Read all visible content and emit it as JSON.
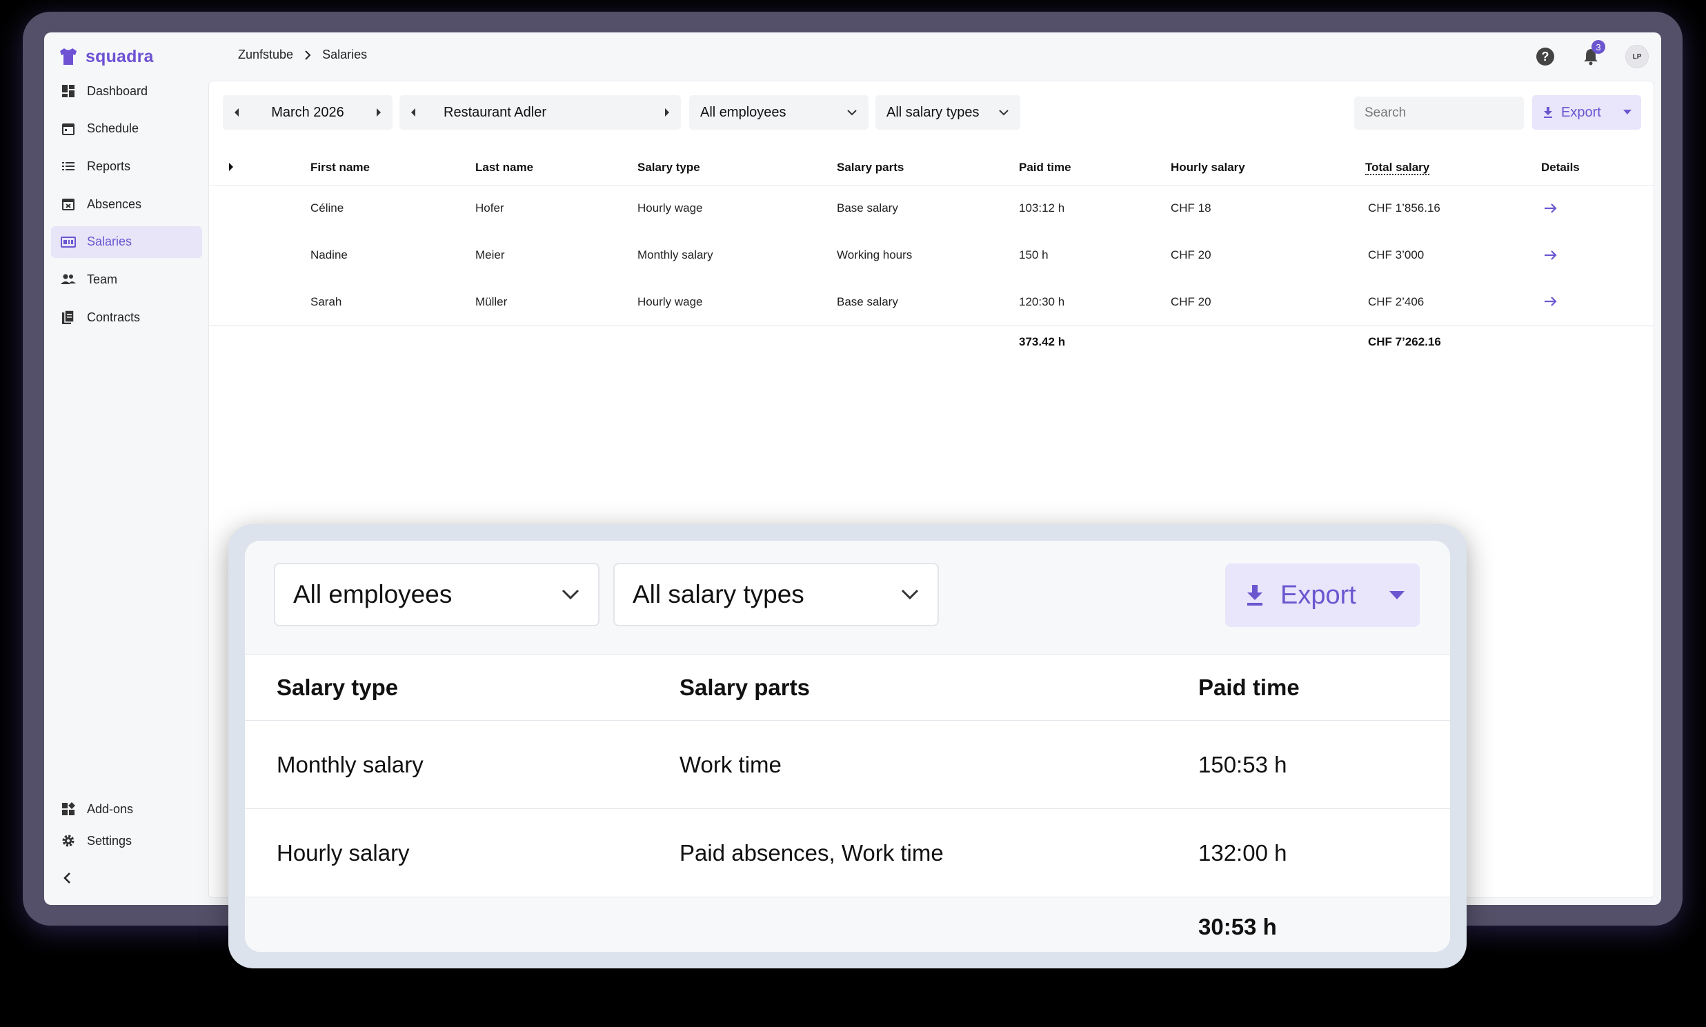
{
  "app": {
    "name": "squadra",
    "brand_color": "#6e52d3"
  },
  "breadcrumb": [
    "Zunfstube",
    "Salaries"
  ],
  "notifications": {
    "count": "3"
  },
  "user": {
    "initials": "LP"
  },
  "sidebar": {
    "items": [
      {
        "label": "Dashboard",
        "icon": "dashboard-icon"
      },
      {
        "label": "Schedule",
        "icon": "calendar-icon"
      },
      {
        "label": "Reports",
        "icon": "list-icon"
      },
      {
        "label": "Absences",
        "icon": "calendar-x-icon"
      },
      {
        "label": "Salaries",
        "icon": "salary-icon",
        "active": true
      },
      {
        "label": "Team",
        "icon": "team-icon"
      },
      {
        "label": "Contracts",
        "icon": "document-icon"
      }
    ],
    "bottom": [
      {
        "label": "Add-ons",
        "icon": "addons-icon"
      },
      {
        "label": "Settings",
        "icon": "gear-icon"
      }
    ]
  },
  "toolbar": {
    "period": "March 2026",
    "location": "Restaurant Adler",
    "employee_filter": "All employees",
    "salary_type_filter": "All salary types",
    "search_placeholder": "Search",
    "export_label": "Export"
  },
  "table": {
    "columns": [
      "First name",
      "Last name",
      "Salary type",
      "Salary parts",
      "Paid time",
      "Hourly salary",
      "Total salary",
      "Details"
    ],
    "rows": [
      {
        "first": "Céline",
        "last": "Hofer",
        "type": "Hourly wage",
        "parts": "Base salary",
        "paid": "103:12 h",
        "hourly": "CHF 18",
        "total": "CHF 1’856.16"
      },
      {
        "first": "Nadine",
        "last": "Meier",
        "type": "Monthly salary",
        "parts": "Working hours",
        "paid": "150 h",
        "hourly": "CHF 20",
        "total": "CHF 3’000"
      },
      {
        "first": "Sarah",
        "last": "Müller",
        "type": "Hourly wage",
        "parts": "Base salary",
        "paid": "120:30 h",
        "hourly": "CHF 20",
        "total": "CHF 2’406"
      }
    ],
    "totals": {
      "paid": "373.42 h",
      "total": "CHF 7’262.16"
    }
  },
  "callout": {
    "employee_filter": "All employees",
    "salary_type_filter": "All salary types",
    "export_label": "Export",
    "columns": [
      "Salary type",
      "Salary parts",
      "Paid time"
    ],
    "rows": [
      {
        "type": "Monthly salary",
        "parts": "Work time",
        "paid": "150:53 h"
      },
      {
        "type": "Hourly salary",
        "parts": "Paid absences, Work time",
        "paid": "132:00 h"
      }
    ],
    "total": "30:53 h"
  }
}
